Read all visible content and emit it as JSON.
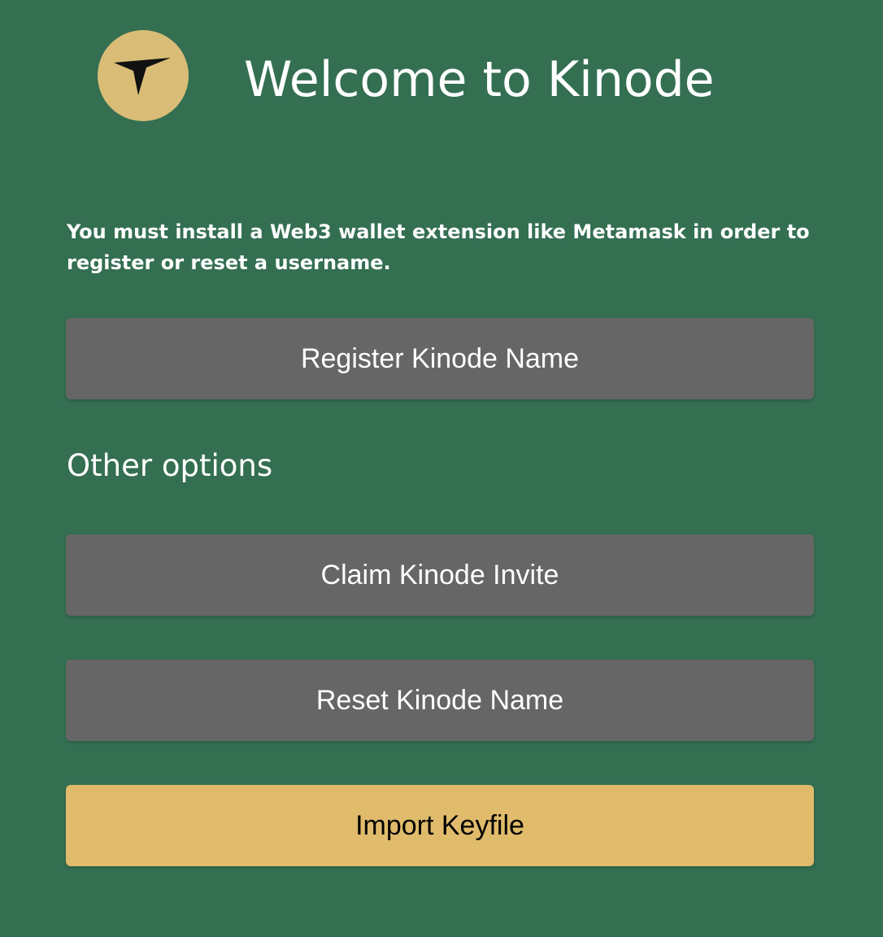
{
  "header": {
    "logo_icon": "kinode-bird-icon",
    "title": "Welcome to Kinode"
  },
  "notice": {
    "text": "You must install a Web3 wallet extension like Metamask in order to register or reset a username."
  },
  "actions": {
    "register_label": "Register Kinode Name"
  },
  "other_options": {
    "heading": "Other options",
    "claim_invite_label": "Claim Kinode Invite",
    "reset_name_label": "Reset Kinode Name",
    "import_keyfile_label": "Import Keyfile"
  },
  "colors": {
    "background": "#346f52",
    "button_gray": "#666666",
    "button_gold": "#dfbb6b",
    "logo_gold": "#d9bd76"
  }
}
